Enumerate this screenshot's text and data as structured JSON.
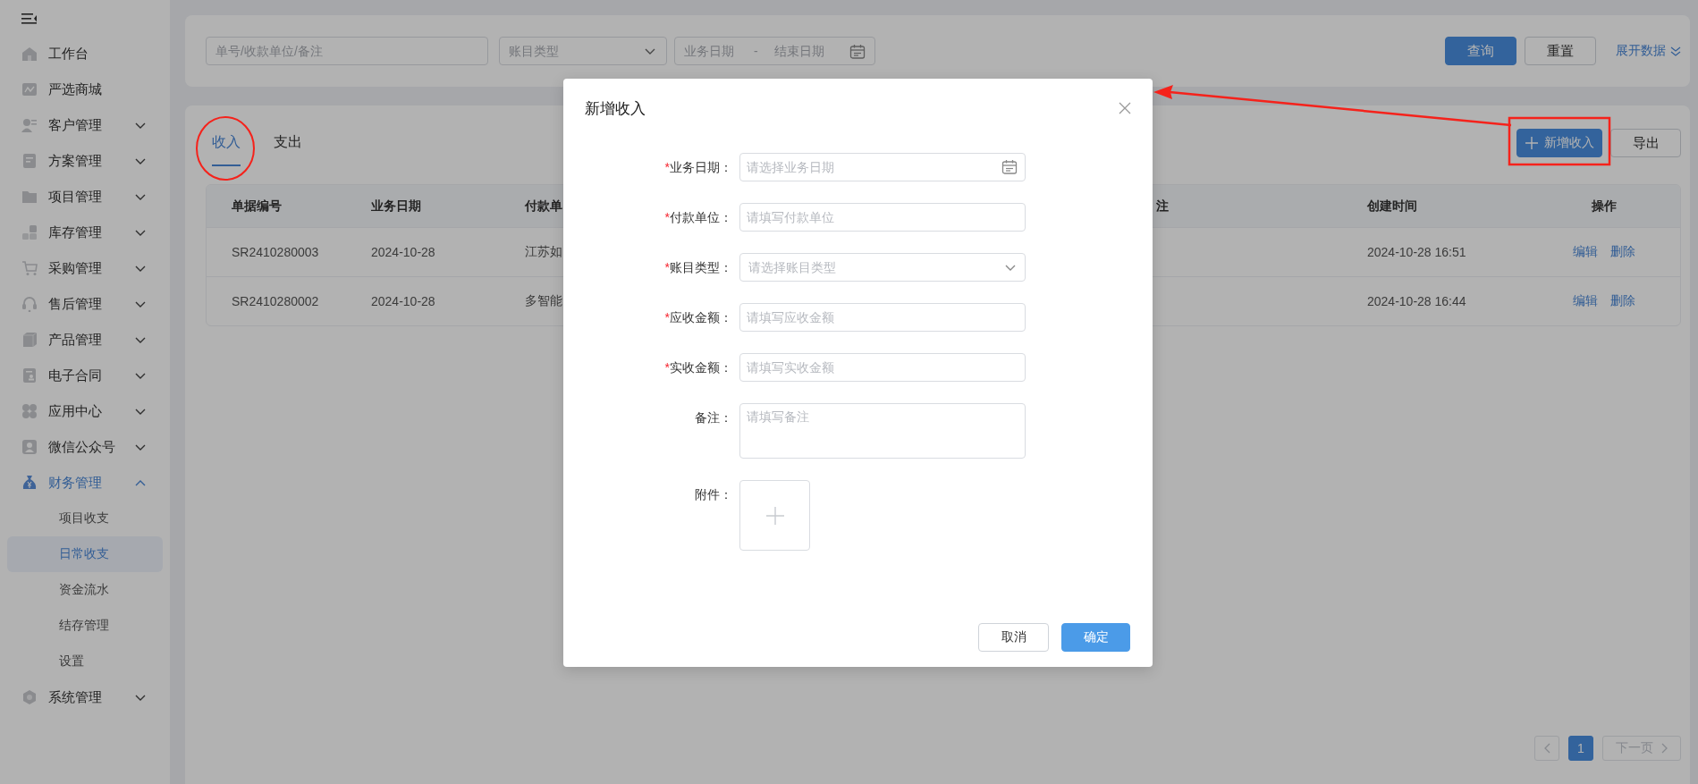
{
  "sidebar": {
    "items": [
      {
        "label": "工作台",
        "kind": "link",
        "selected": false
      },
      {
        "label": "严选商城",
        "kind": "link",
        "selected": false
      },
      {
        "label": "客户管理",
        "kind": "group",
        "expanded": false,
        "selected": false
      },
      {
        "label": "方案管理",
        "kind": "group",
        "expanded": false,
        "selected": false
      },
      {
        "label": "项目管理",
        "kind": "group",
        "expanded": false,
        "selected": false
      },
      {
        "label": "库存管理",
        "kind": "group",
        "expanded": false,
        "selected": false
      },
      {
        "label": "采购管理",
        "kind": "group",
        "expanded": false,
        "selected": false
      },
      {
        "label": "售后管理",
        "kind": "group",
        "expanded": false,
        "selected": false
      },
      {
        "label": "产品管理",
        "kind": "group",
        "expanded": false,
        "selected": false
      },
      {
        "label": "电子合同",
        "kind": "group",
        "expanded": false,
        "selected": false
      },
      {
        "label": "应用中心",
        "kind": "group",
        "expanded": false,
        "selected": false
      },
      {
        "label": "微信公众号",
        "kind": "group",
        "expanded": false,
        "selected": false
      },
      {
        "label": "财务管理",
        "kind": "group",
        "expanded": true,
        "selected": true,
        "children": [
          {
            "label": "项目收支",
            "selected": false
          },
          {
            "label": "日常收支",
            "selected": true
          },
          {
            "label": "资金流水",
            "selected": false
          },
          {
            "label": "结存管理",
            "selected": false
          },
          {
            "label": "设置",
            "selected": false
          }
        ]
      },
      {
        "label": "系统管理",
        "kind": "group",
        "expanded": false,
        "selected": false
      }
    ]
  },
  "filter": {
    "keyword_placeholder": "单号/收款单位/备注",
    "type_placeholder": "账目类型",
    "start_placeholder": "业务日期",
    "separator": "-",
    "end_placeholder": "结束日期",
    "buttons": [
      {
        "label": "查询",
        "kind": "primary"
      },
      {
        "label": "重置",
        "kind": "default"
      }
    ],
    "expand_link": "展开数据"
  },
  "tabs": [
    {
      "label": "收入",
      "selected": true
    },
    {
      "label": "支出",
      "selected": false
    }
  ],
  "actions": [
    {
      "label": "新增收入",
      "kind": "primary"
    },
    {
      "label": "导出",
      "kind": "default"
    }
  ],
  "table": {
    "columns": [
      "单据编号",
      "业务日期",
      "付款单",
      "注",
      "创建时间",
      "操作"
    ],
    "rows": [
      {
        "number": "SR2410280003",
        "date": "2024-10-28",
        "payer": "江苏如",
        "created": "2024-10-28 16:51",
        "actions": [
          "编辑",
          "删除"
        ]
      },
      {
        "number": "SR2410280002",
        "date": "2024-10-28",
        "payer": "多智能",
        "created": "2024-10-28 16:44",
        "actions": [
          "编辑",
          "删除"
        ]
      }
    ]
  },
  "pagination": {
    "prev_disabled": true,
    "pages": [
      {
        "label": "1",
        "selected": true
      }
    ],
    "next_label": "下一页",
    "next_disabled": true
  },
  "dialog": {
    "title": "新增收入",
    "required_mark": "*",
    "fields": [
      {
        "label": "业务日期：",
        "required": true,
        "kind": "date",
        "placeholder": "请选择业务日期"
      },
      {
        "label": "付款单位：",
        "required": true,
        "kind": "text",
        "placeholder": "请填写付款单位"
      },
      {
        "label": "账目类型：",
        "required": true,
        "kind": "select",
        "placeholder": "请选择账目类型"
      },
      {
        "label": "应收金额：",
        "required": true,
        "kind": "text",
        "placeholder": "请填写应收金额"
      },
      {
        "label": "实收金额：",
        "required": true,
        "kind": "text",
        "placeholder": "请填写实收金额"
      },
      {
        "label": "备注：",
        "required": false,
        "kind": "textarea",
        "placeholder": "请填写备注"
      },
      {
        "label": "附件：",
        "required": false,
        "kind": "upload"
      }
    ],
    "buttons": [
      {
        "label": "取消",
        "kind": "default"
      },
      {
        "label": "确定",
        "kind": "primary"
      }
    ]
  },
  "annotations": [
    {
      "kind": "circle"
    },
    {
      "kind": "box"
    },
    {
      "kind": "arrow"
    }
  ]
}
